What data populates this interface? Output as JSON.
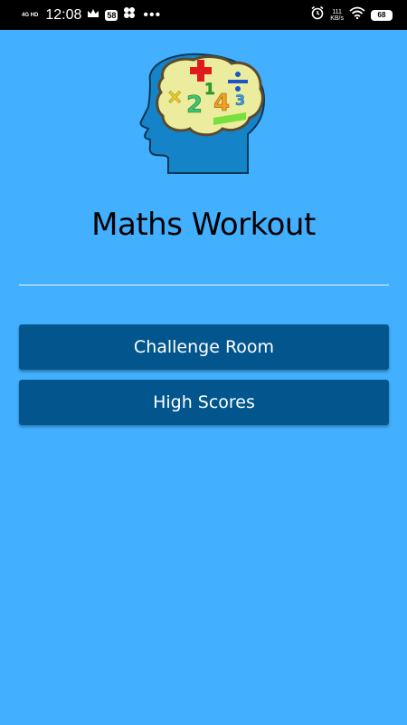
{
  "status_bar": {
    "network": "4G HD",
    "time": "12:08",
    "badge": "58",
    "more": "•••",
    "speed_value": "111",
    "speed_unit": "KB/s",
    "battery": "68"
  },
  "app": {
    "title": "Maths Workout"
  },
  "menu": {
    "challenge_label": "Challenge Room",
    "scores_label": "High Scores"
  },
  "colors": {
    "background": "#42b0ff",
    "button": "#02568d",
    "button_text": "#ffffff"
  }
}
